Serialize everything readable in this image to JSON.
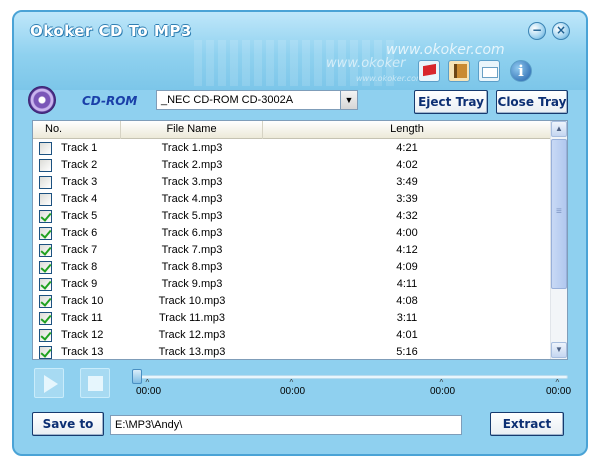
{
  "app": {
    "title": "Okoker CD To MP3"
  },
  "window_buttons": {
    "minimize": "−",
    "close": "×"
  },
  "branding": {
    "watermark": "www.okoker.com",
    "watermark_partial": "www.okoker",
    "watermark_small": "www.okoker.com"
  },
  "toolbar_icons": [
    "flag-icon",
    "book-icon",
    "mail-icon",
    "info-icon"
  ],
  "drive": {
    "label": "CD-ROM",
    "selected": "_NEC    CD-ROM CD-3002A",
    "eject_label": "Eject Tray",
    "close_label": "Close Tray"
  },
  "table": {
    "columns": [
      "No.",
      "File Name",
      "Length"
    ],
    "rows": [
      {
        "no": "Track 1",
        "file": "Track 1.mp3",
        "length": "4:21",
        "checked": false
      },
      {
        "no": "Track 2",
        "file": "Track 2.mp3",
        "length": "4:02",
        "checked": false
      },
      {
        "no": "Track 3",
        "file": "Track 3.mp3",
        "length": "3:49",
        "checked": false
      },
      {
        "no": "Track 4",
        "file": "Track 4.mp3",
        "length": "3:39",
        "checked": false
      },
      {
        "no": "Track 5",
        "file": "Track 5.mp3",
        "length": "4:32",
        "checked": true
      },
      {
        "no": "Track 6",
        "file": "Track 6.mp3",
        "length": "4:00",
        "checked": true
      },
      {
        "no": "Track 7",
        "file": "Track 7.mp3",
        "length": "4:12",
        "checked": true
      },
      {
        "no": "Track 8",
        "file": "Track 8.mp3",
        "length": "4:09",
        "checked": true
      },
      {
        "no": "Track 9",
        "file": "Track 9.mp3",
        "length": "4:11",
        "checked": true
      },
      {
        "no": "Track 10",
        "file": "Track 10.mp3",
        "length": "4:08",
        "checked": true
      },
      {
        "no": "Track 11",
        "file": "Track 11.mp3",
        "length": "3:11",
        "checked": true
      },
      {
        "no": "Track 12",
        "file": "Track 12.mp3",
        "length": "4:01",
        "checked": true
      },
      {
        "no": "Track 13",
        "file": "Track 13.mp3",
        "length": "5:16",
        "checked": true
      }
    ]
  },
  "player": {
    "ticks": [
      "00:00",
      "00:00",
      "00:00",
      "00:00"
    ],
    "position": 0
  },
  "output": {
    "save_label": "Save to",
    "path": "E:\\MP3\\Andy\\",
    "extract_label": "Extract"
  },
  "colors": {
    "window": "#8fd0ef",
    "border": "#4aa3d6",
    "button_text": "#0c2f73",
    "check": "#21a121"
  }
}
